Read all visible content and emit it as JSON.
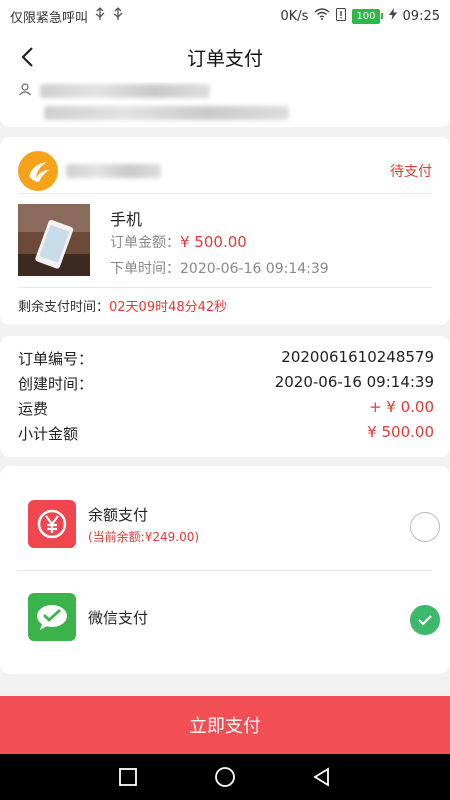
{
  "status_bar": {
    "left_text": "仅限紧急呼叫",
    "network_speed": "0K/s",
    "battery": "100",
    "time": "09:25"
  },
  "header": {
    "title": "订单支付"
  },
  "order": {
    "status": "待支付",
    "product_name": "手机",
    "amount_label": "订单金额：",
    "amount_value": "¥ 500.00",
    "time_label": "下单时间：",
    "time_value": "2020-06-16 09:14:39",
    "countdown_label": "剩余支付时间：",
    "countdown_value": "02天09时48分42秒"
  },
  "details": {
    "order_no_label": "订单编号：",
    "order_no_value": "2020061610248579",
    "created_label": "创建时间：",
    "created_value": "2020-06-16 09:14:39",
    "shipping_label": "运费",
    "shipping_value": "+ ¥ 0.00",
    "subtotal_label": "小计金额",
    "subtotal_value": "¥ 500.00"
  },
  "payment": {
    "balance_label": "余额支付",
    "balance_sub": "(当前余额:¥249.00)",
    "wechat_label": "微信支付",
    "selected": "wechat"
  },
  "actions": {
    "pay_now": "立即支付"
  },
  "colors": {
    "accent_red": "#e53935",
    "pay_button": "#f24f55",
    "wechat_green": "#3cb96a"
  }
}
